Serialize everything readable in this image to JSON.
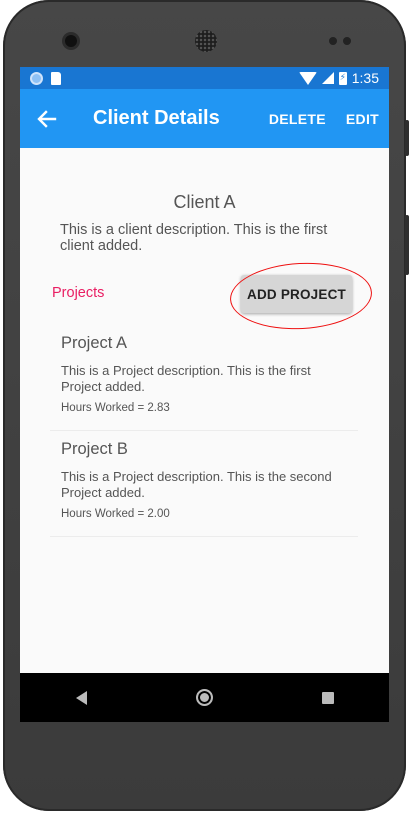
{
  "status_bar": {
    "time": "1:35"
  },
  "app_bar": {
    "title": "Client Details",
    "actions": [
      "DELETE",
      "EDIT"
    ]
  },
  "client": {
    "name": "Client A",
    "description": "This is a client description. This is the first client added."
  },
  "projects_section": {
    "label": "Projects",
    "add_button": "ADD PROJECT"
  },
  "projects": [
    {
      "name": "Project A",
      "description": "This is a Project description. This is the first Project added.",
      "hours": "Hours Worked = 2.83"
    },
    {
      "name": "Project B",
      "description": "This is a Project description. This is the second Project added.",
      "hours": "Hours Worked = 2.00"
    }
  ],
  "colors": {
    "status_bar": "#1976d2",
    "app_bar": "#2196f3",
    "accent": "#e91e63",
    "annotation": "#e11111"
  },
  "icons": [
    "back-arrow-icon",
    "nav-back-icon",
    "nav-home-icon",
    "nav-recent-icon",
    "wifi-icon",
    "signal-icon",
    "battery-icon"
  ]
}
